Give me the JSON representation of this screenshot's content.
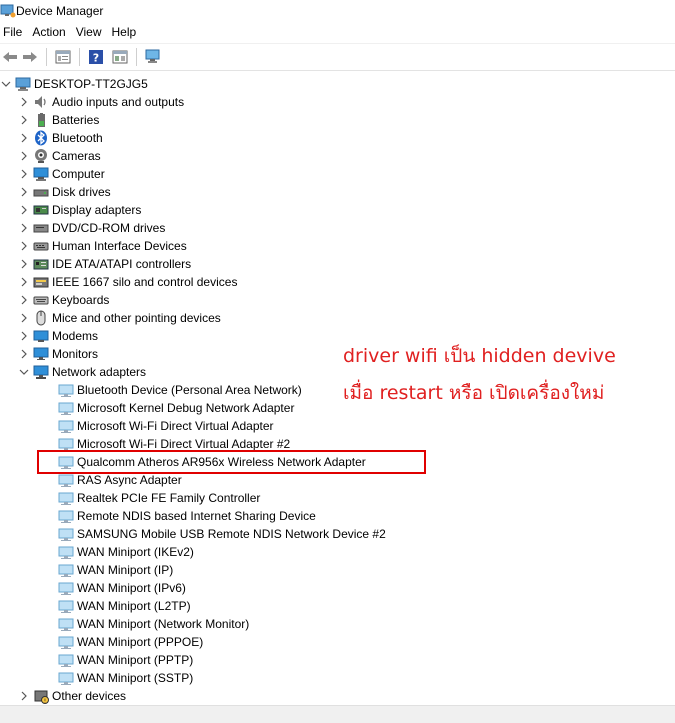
{
  "window": {
    "title": "Device Manager"
  },
  "menu": [
    "File",
    "Action",
    "View",
    "Help"
  ],
  "toolbar": {
    "buttons": [
      "back-icon",
      "forward-icon",
      "properties-icon",
      "help-icon",
      "view-icon",
      "scan-hardware-icon"
    ]
  },
  "tree": {
    "root": "DESKTOP-TT2GJG5",
    "categories": [
      {
        "label": "Audio inputs and outputs",
        "icon": "speaker-icon"
      },
      {
        "label": "Batteries",
        "icon": "battery-icon"
      },
      {
        "label": "Bluetooth",
        "icon": "bluetooth-icon"
      },
      {
        "label": "Cameras",
        "icon": "camera-icon"
      },
      {
        "label": "Computer",
        "icon": "computer-icon"
      },
      {
        "label": "Disk drives",
        "icon": "disk-drive-icon"
      },
      {
        "label": "Display adapters",
        "icon": "display-adapter-icon"
      },
      {
        "label": "DVD/CD-ROM drives",
        "icon": "dvd-drive-icon"
      },
      {
        "label": "Human Interface Devices",
        "icon": "hid-icon"
      },
      {
        "label": "IDE ATA/ATAPI controllers",
        "icon": "ide-controller-icon"
      },
      {
        "label": "IEEE 1667 silo and control devices",
        "icon": "ieee-device-icon"
      },
      {
        "label": "Keyboards",
        "icon": "keyboard-icon"
      },
      {
        "label": "Mice and other pointing devices",
        "icon": "mouse-icon"
      },
      {
        "label": "Modems",
        "icon": "modem-icon"
      },
      {
        "label": "Monitors",
        "icon": "monitor-icon"
      },
      {
        "label": "Network adapters",
        "icon": "network-adapter-icon"
      }
    ],
    "network_adapters": [
      "Bluetooth Device (Personal Area Network)",
      "Microsoft Kernel Debug Network Adapter",
      "Microsoft Wi-Fi Direct Virtual Adapter",
      "Microsoft Wi-Fi Direct Virtual Adapter #2",
      "Qualcomm Atheros AR956x Wireless Network Adapter",
      "RAS Async Adapter",
      "Realtek PCIe FE Family Controller",
      "Remote NDIS based Internet Sharing Device",
      "SAMSUNG Mobile USB Remote NDIS Network Device #2",
      "WAN Miniport (IKEv2)",
      "WAN Miniport (IP)",
      "WAN Miniport (IPv6)",
      "WAN Miniport (L2TP)",
      "WAN Miniport (Network Monitor)",
      "WAN Miniport (PPPOE)",
      "WAN Miniport (PPTP)",
      "WAN Miniport (SSTP)"
    ],
    "after": {
      "label": "Other devices",
      "icon": "other-devices-icon"
    }
  },
  "annotation": {
    "line1": "driver wifi เป็น hidden devive",
    "line2": "เมื่อ restart หรือ เปิดเครื่องใหม่",
    "color": "#e02020"
  },
  "colors": {
    "highlight": "#e00000"
  }
}
